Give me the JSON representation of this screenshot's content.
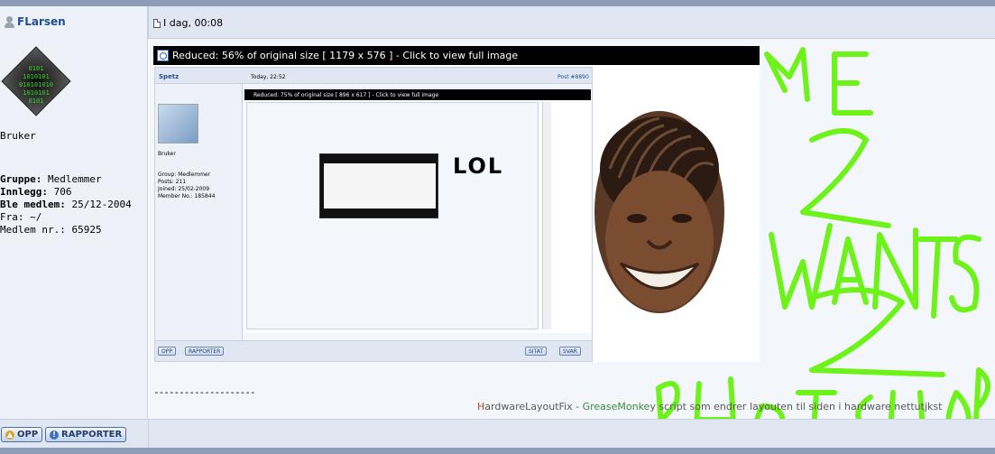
{
  "post": {
    "author": "FLarsen",
    "date": "I dag, 00:08"
  },
  "profile": {
    "avatar_text": "0101\n010101010\n0101",
    "rank": "Bruker",
    "group_label": "Gruppe:",
    "group_value": "Medlemmer",
    "posts_label": "Innlegg:",
    "posts_value": "706",
    "member_since_label": "Ble medlem:",
    "member_since_value": "25/12-2004",
    "from": "Fra: ~/",
    "member_no": "Medlem nr.: 65925"
  },
  "image": {
    "reduced_text": "Reduced: 56% of original size [ 1179 x 576 ] - Click to view full image"
  },
  "inner_post": {
    "author": "Spetz",
    "date": "Today, 22:52",
    "post_label": "Post",
    "post_number": "#8890",
    "rank": "Bruker",
    "stats": [
      "Group: Medlemmer",
      "Posts: 211",
      "Joined: 25/02-2009",
      "Member No.: 185844"
    ],
    "reduced_text": "Reduced: 75% of original size [ 896 x 617 ] - Click to view full image",
    "buttons": {
      "opp": "OPP",
      "rapporter": "RAPPORTER",
      "sitat": "SITAT",
      "svar": "SVAR"
    }
  },
  "doodle_text": "LOL",
  "scrawl_text": [
    "ME",
    "2",
    "WANTS",
    "2",
    "PHOTOSHOP"
  ],
  "signature": {
    "dashes": "--------------------",
    "h_letter": "H",
    "fix_text": "ardwareLayoutFix - ",
    "gm_text": "GreaseMonke",
    "rest_text": "y script som endrer layouten til siden i hardware nettutjkst"
  },
  "footer": {
    "opp_label": "OPP",
    "rapporter_label": "RAPPORTER"
  },
  "colors": {
    "header_bg": "#e1e7f2",
    "sidebar_bg": "#eef1f7",
    "author_link": "#1f4f95",
    "scrawl_green": "#6df21a"
  }
}
